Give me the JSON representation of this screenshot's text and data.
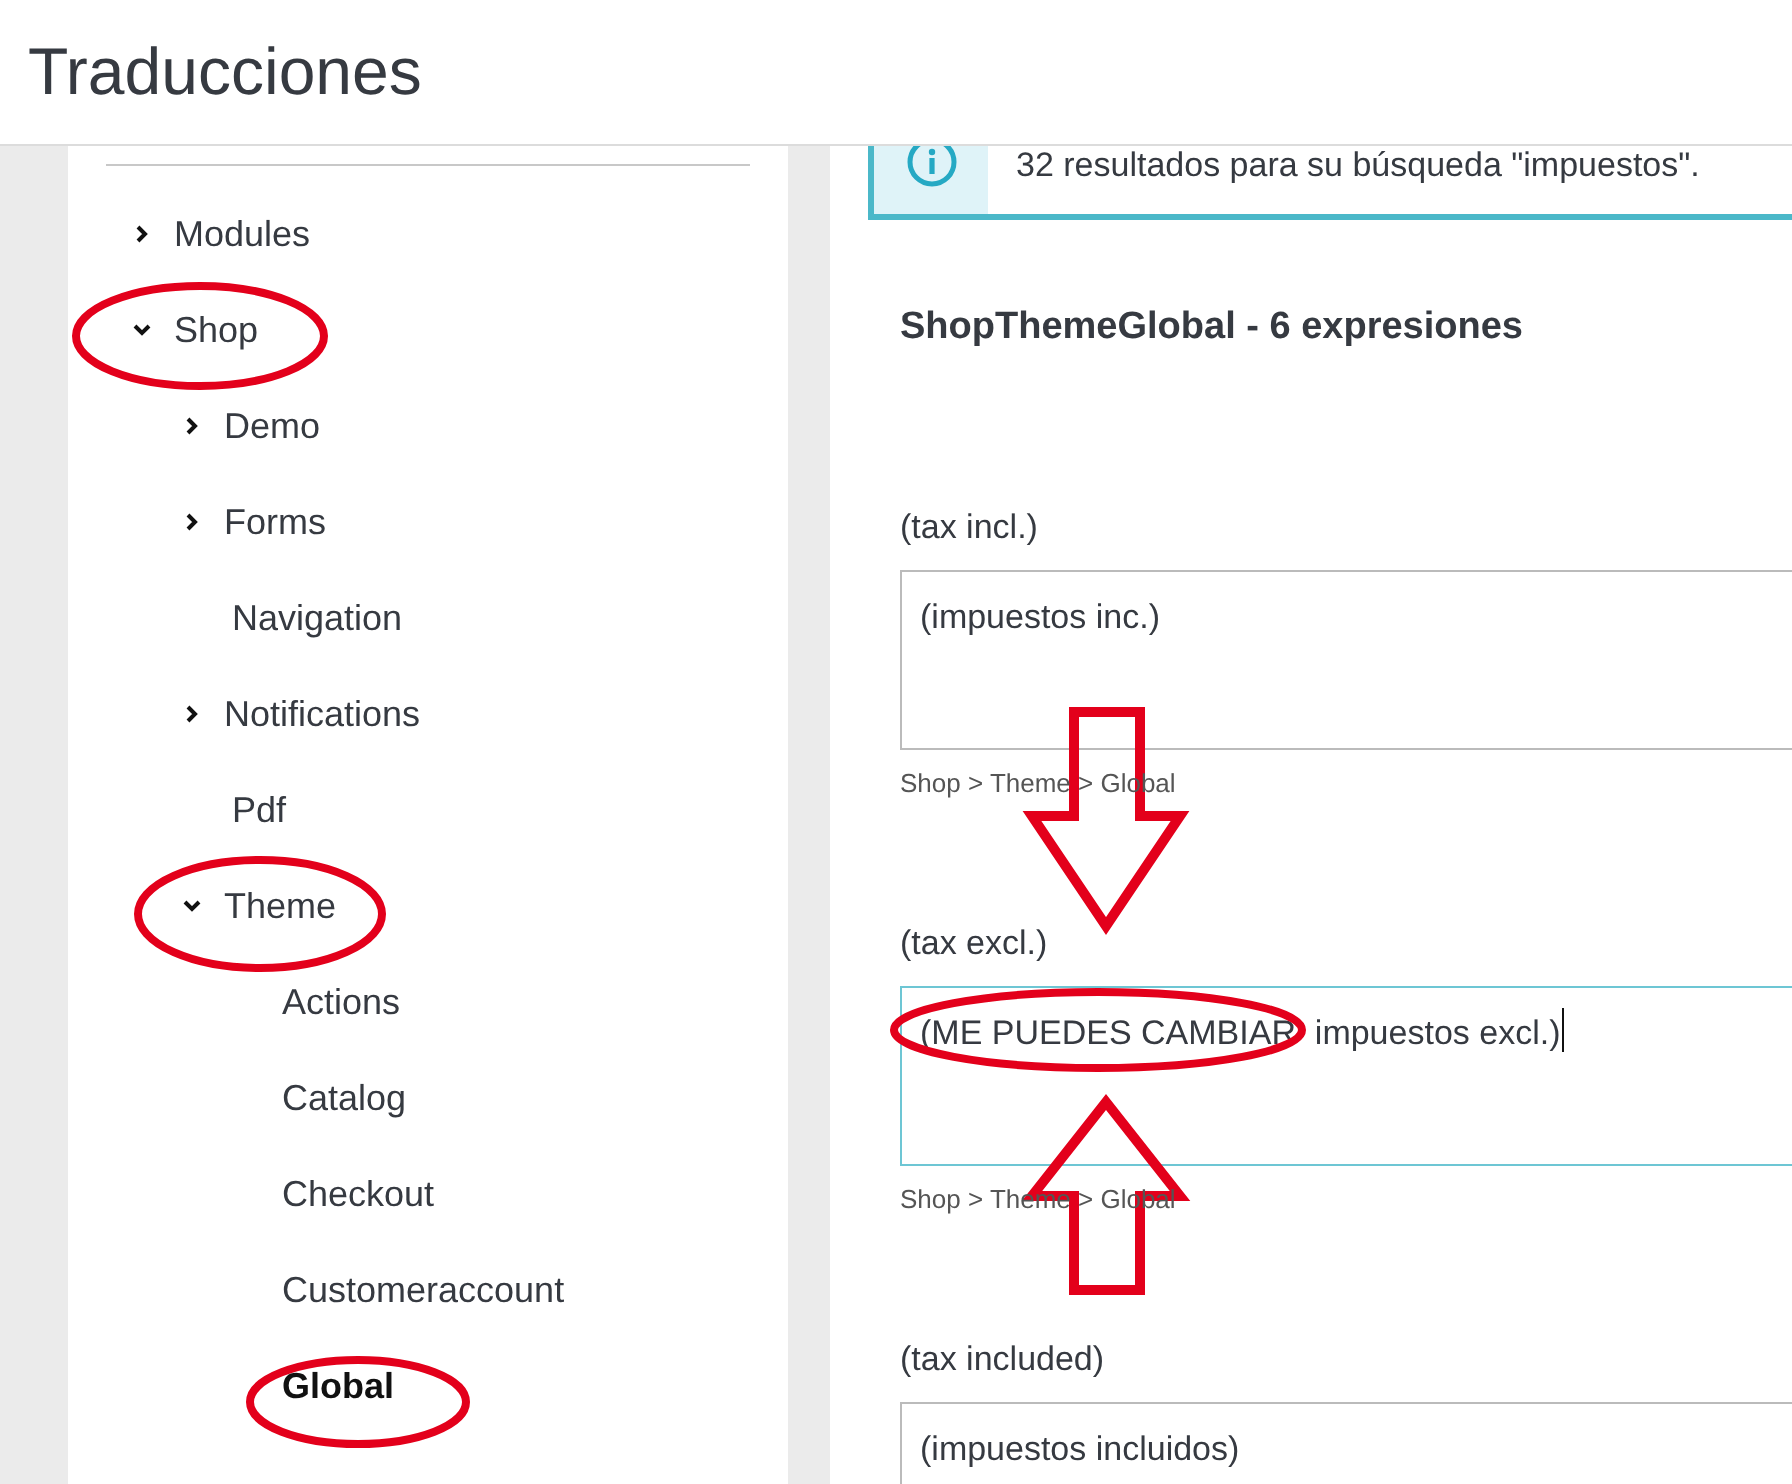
{
  "header": {
    "title": "Traducciones"
  },
  "tree": [
    {
      "label": "Modules",
      "kind": "folder",
      "expanded": false,
      "selected": false
    },
    {
      "label": "Shop",
      "kind": "folder",
      "expanded": true,
      "selected": false,
      "children": [
        {
          "label": "Demo",
          "kind": "folder",
          "expanded": false,
          "selected": false
        },
        {
          "label": "Forms",
          "kind": "folder",
          "expanded": false,
          "selected": false
        },
        {
          "label": "Navigation",
          "kind": "leaf",
          "selected": false
        },
        {
          "label": "Notifications",
          "kind": "folder",
          "expanded": false,
          "selected": false
        },
        {
          "label": "Pdf",
          "kind": "leaf",
          "selected": false
        },
        {
          "label": "Theme",
          "kind": "folder",
          "expanded": true,
          "selected": false,
          "children": [
            {
              "label": "Actions",
              "kind": "leaf",
              "selected": false
            },
            {
              "label": "Catalog",
              "kind": "leaf",
              "selected": false
            },
            {
              "label": "Checkout",
              "kind": "leaf",
              "selected": false
            },
            {
              "label": "Customeraccount",
              "kind": "leaf",
              "selected": false
            },
            {
              "label": "Global",
              "kind": "leaf",
              "selected": true
            }
          ]
        }
      ]
    }
  ],
  "alert": {
    "text": "32 resultados para su búsqueda \"impuestos\"."
  },
  "section": {
    "title": "ShopThemeGlobal - 6 expresiones",
    "entries": [
      {
        "label": "(tax incl.)",
        "value": "(impuestos inc.)",
        "focused": false,
        "path": "Shop > Theme > Global"
      },
      {
        "label": "(tax excl.)",
        "value": "(ME PUEDES CAMBIAR  impuestos excl.)",
        "focused": true,
        "path": "Shop > Theme > Global"
      },
      {
        "label": "(tax included)",
        "value": "(impuestos incluidos)",
        "focused": false
      }
    ]
  }
}
